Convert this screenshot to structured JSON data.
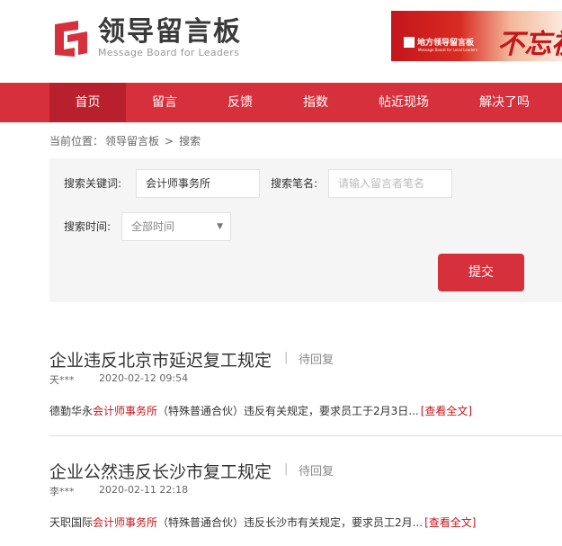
{
  "header": {
    "logo_cn": "领导留言板",
    "logo_en": "Message Board for Leaders",
    "banner": {
      "logo_text": "地方领导留言板",
      "sub_text": "Message Board for Local Leaders",
      "script_text": "不忘初"
    }
  },
  "nav": {
    "items": [
      {
        "label": "首页",
        "active": true
      },
      {
        "label": "留言",
        "active": false
      },
      {
        "label": "反馈",
        "active": false
      },
      {
        "label": "指数",
        "active": false
      },
      {
        "label": "帖近现场",
        "active": false
      },
      {
        "label": "解决了吗",
        "active": false
      }
    ]
  },
  "breadcrumb": {
    "prefix": "当前位置：",
    "items": [
      "领导留言板",
      "搜索"
    ],
    "separator": ">"
  },
  "search": {
    "keyword_label": "搜索关键词:",
    "keyword_value": "会计师事务所",
    "name_label": "搜索笔名:",
    "name_placeholder": "请输入留言者笔名",
    "time_label": "搜索时间:",
    "time_value": "全部时间",
    "submit_label": "提交"
  },
  "results": [
    {
      "title": "企业违反北京市延迟复工规定",
      "status": "待回复",
      "author": "天***",
      "time": "2020-02-12 09:54",
      "summary_before": "德勤华永",
      "summary_highlight": "会计师事务所",
      "summary_after": "（特殊普通合伙）违反有关规定，要求员工于2月3日...",
      "more_label": "[查看全文]"
    },
    {
      "title": "企业公然违反长沙市复工规定",
      "status": "待回复",
      "author": "李***",
      "time": "2020-02-11 22:18",
      "summary_before": "天职国际",
      "summary_highlight": "会计师事务所",
      "summary_after": "（特殊普通合伙）违反长沙市有关规定，要求员工2月...",
      "more_label": "[查看全文]"
    }
  ],
  "colors": {
    "brand_red": "#d6303c",
    "nav_active": "#b7202c",
    "highlight": "#c4161c",
    "panel_bg": "#f5f5f5"
  }
}
